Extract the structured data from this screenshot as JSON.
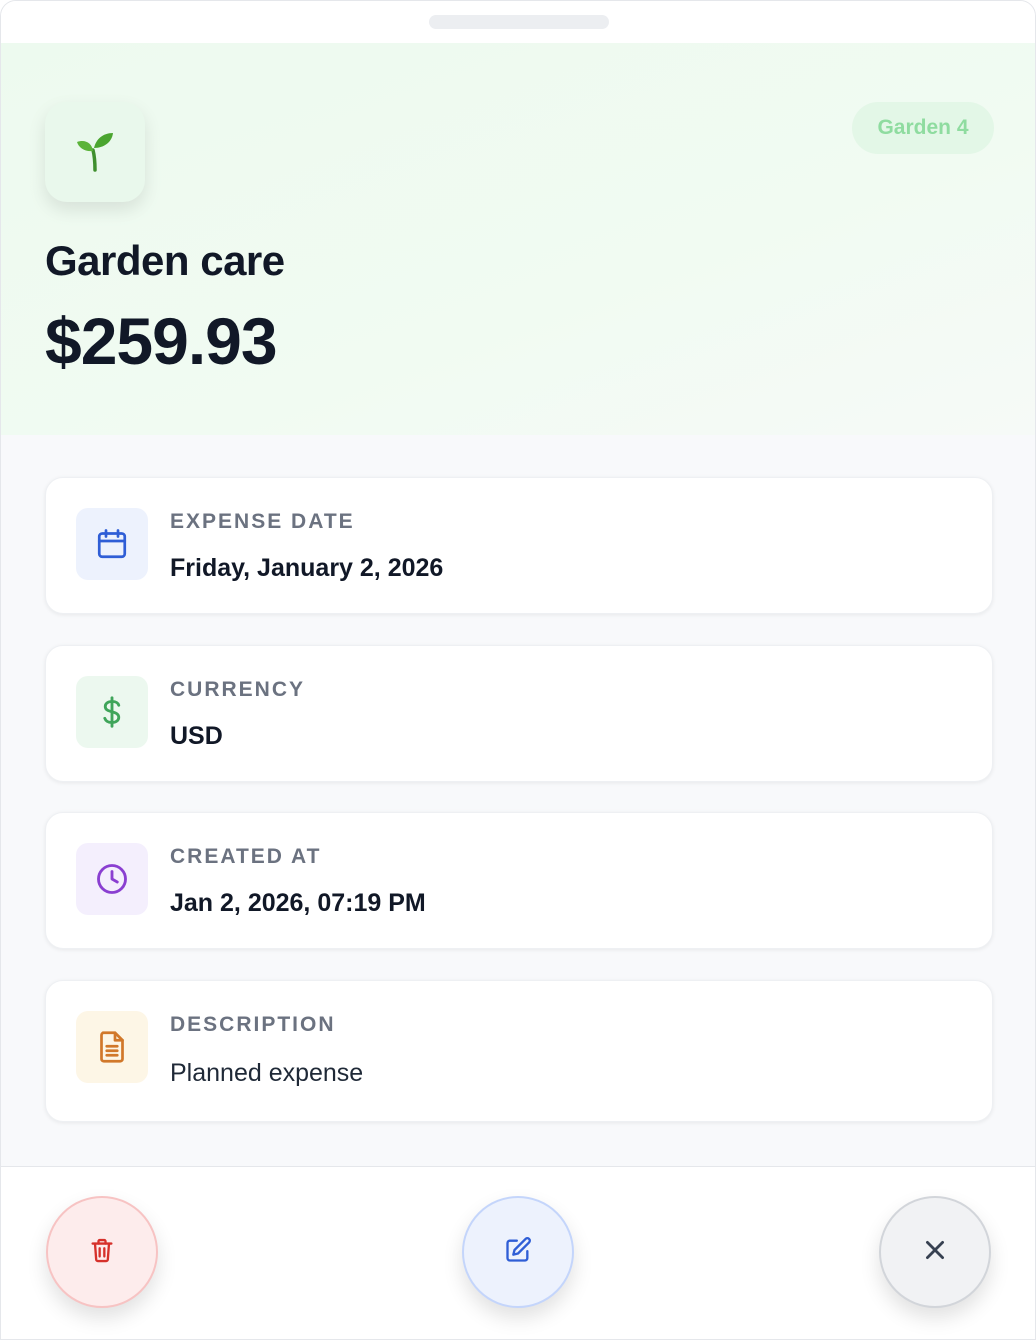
{
  "expense": {
    "category_icon": "seedling-icon",
    "tag": "Garden 4",
    "title": "Garden care",
    "amount": "$259.93"
  },
  "details": [
    {
      "label": "EXPENSE DATE",
      "value": "Friday, January 2, 2026",
      "icon": "calendar-icon",
      "icon_color": "#2f5ed6",
      "icon_bg": "#edf2fd"
    },
    {
      "label": "CURRENCY",
      "value": "USD",
      "icon": "dollar-icon",
      "icon_color": "#3fa55a",
      "icon_bg": "#ecf8ef"
    },
    {
      "label": "CREATED AT",
      "value": "Jan 2, 2026, 07:19 PM",
      "icon": "clock-icon",
      "icon_color": "#8a3fd1",
      "icon_bg": "#f4effd"
    },
    {
      "label": "DESCRIPTION",
      "value": "Planned expense",
      "icon": "document-icon",
      "icon_color": "#d1782a",
      "icon_bg": "#fdf6e6"
    }
  ],
  "actions": {
    "delete_icon": "trash-icon",
    "edit_icon": "edit-icon",
    "close_icon": "close-icon"
  },
  "colors": {
    "hero_bg": "#edfaef",
    "tag_text": "#8fdca0",
    "delete": "#d6312b",
    "edit": "#2f5ed6",
    "close": "#374151"
  }
}
